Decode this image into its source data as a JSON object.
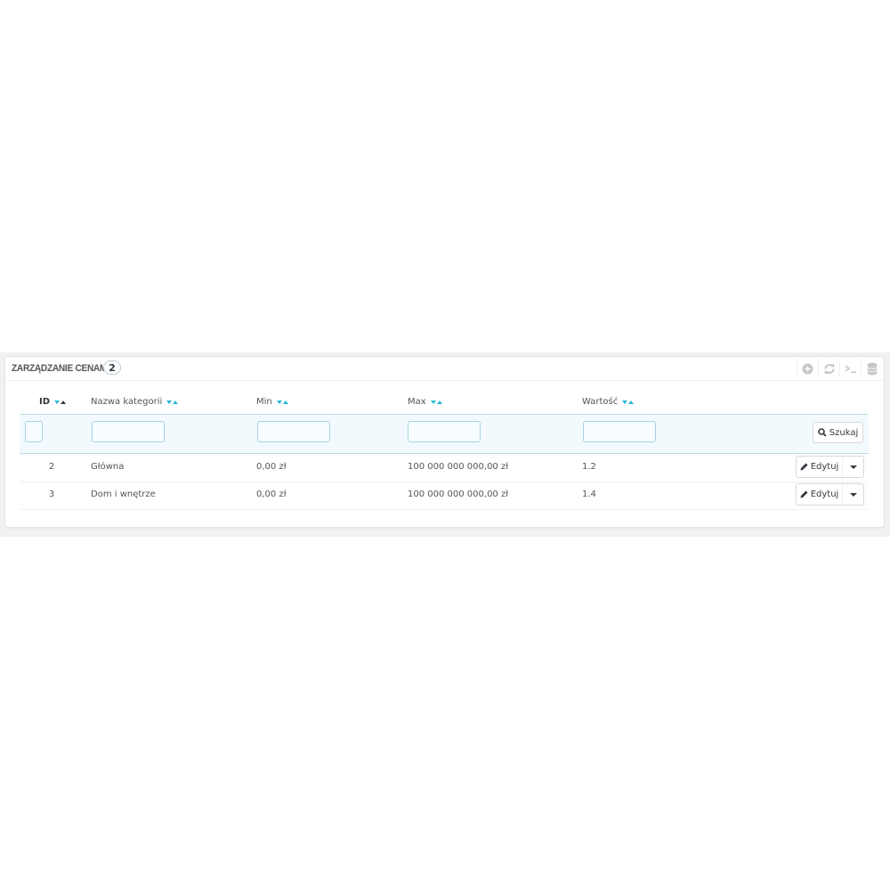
{
  "panel": {
    "title": "ZARZĄDZANIE CENAMI",
    "count": "2",
    "toolbar_icons": [
      "add-icon",
      "refresh-icon",
      "sql-query-icon",
      "export-database-icon"
    ]
  },
  "table": {
    "columns": [
      {
        "label": "ID",
        "sorted": "ascending"
      },
      {
        "label": "Nazwa kategorii"
      },
      {
        "label": "Min"
      },
      {
        "label": "Max"
      },
      {
        "label": "Wartość"
      }
    ],
    "search_label": "Szukaj",
    "rows": [
      {
        "id": "2",
        "name": "Główna",
        "min": "0,00 zł",
        "max": "100 000 000 000,00 zł",
        "value": "1.2",
        "action": "Edytuj"
      },
      {
        "id": "3",
        "name": "Dom i wnętrze",
        "min": "0,00 zł",
        "max": "100 000 000 000,00 zł",
        "value": "1.4",
        "action": "Edytuj"
      }
    ]
  },
  "colors": {
    "accent": "#25b9d7",
    "filter_background": "#f3fafd",
    "page_band": "#eff1f2"
  }
}
